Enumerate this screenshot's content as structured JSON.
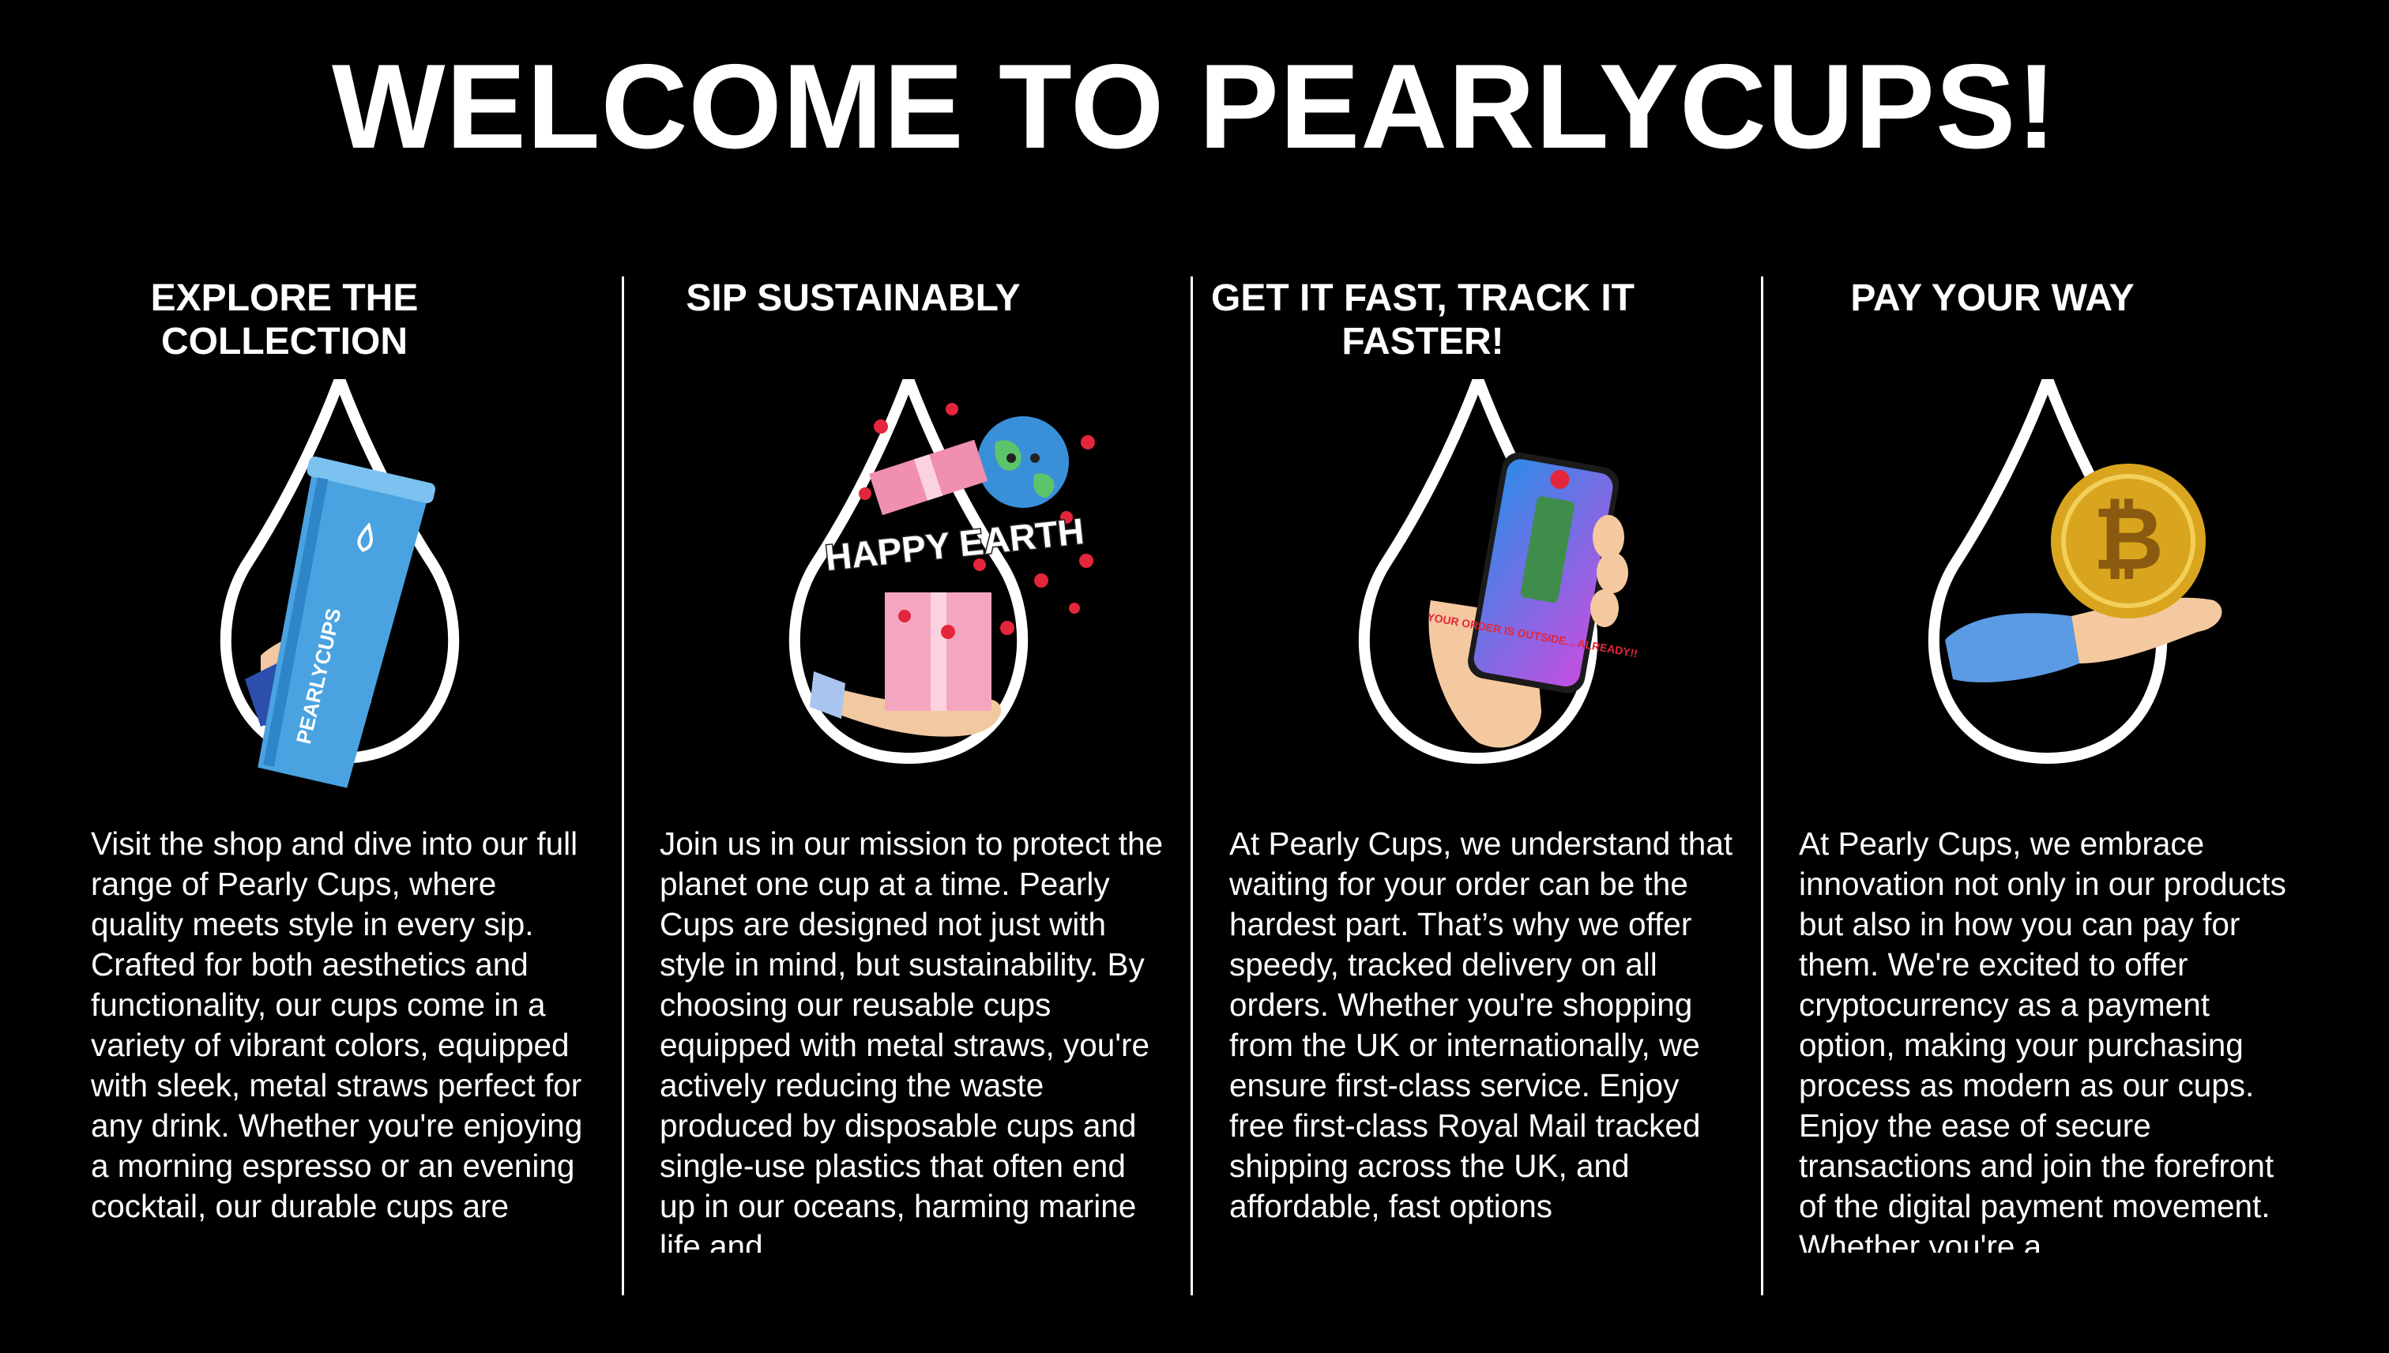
{
  "page": {
    "title": "WELCOME TO PEARLYCUPS!"
  },
  "colors": {
    "background": "#000000",
    "text": "#ffffff",
    "cup_blue": "#4aa3e0",
    "gift_pink": "#f4a6c0",
    "phone_gradient_start": "#2f8ae8",
    "phone_gradient_end": "#c44fe0",
    "coin_gold": "#d9a51e"
  },
  "columns": [
    {
      "heading": "EXPLORE THE COLLECTION",
      "image_icon": "blue-cup-hand-icon",
      "image_text": "PEARLYCUPS",
      "body": "Visit the shop and dive into our full range of Pearly Cups, where quality meets style in every sip. Crafted for both aesthetics and functionality, our cups come in a variety of vibrant colors, equipped with sleek, metal straws perfect for any drink. Whether you're enjoying a morning espresso or an evening cocktail, our durable cups are"
    },
    {
      "heading": "SIP SUSTAINABLY",
      "image_icon": "happy-earth-gift-icon",
      "image_text": "HAPPY EARTH",
      "body": "Join us in our mission to protect the planet one cup at a time. Pearly Cups are designed not just with style in mind, but sustainability. By choosing our reusable cups equipped with metal straws, you're actively reducing the waste produced by disposable cups and single-use plastics that often end up in our oceans, harming marine life and"
    },
    {
      "heading": "GET IT FAST, TRACK IT FASTER!",
      "image_icon": "phone-order-icon",
      "image_text": "YOUR ORDER IS OUTSIDE... ALREADY!!",
      "body": "At Pearly Cups, we understand that waiting for your order can be the hardest part. That’s why we offer speedy, tracked delivery on all orders. Whether you're shopping from the UK or internationally, we ensure first-class service. Enjoy free first-class Royal Mail tracked shipping across the UK, and affordable, fast options"
    },
    {
      "heading": "PAY YOUR WAY",
      "image_icon": "bitcoin-hand-icon",
      "image_text": "",
      "body": "At Pearly Cups, we embrace innovation not only in our products but also in how you can pay for them. We're excited to offer cryptocurrency as a payment option, making your purchasing process as modern as our cups. Enjoy the ease of secure transactions and join the forefront of the digital payment movement. Whether you're a"
    }
  ]
}
